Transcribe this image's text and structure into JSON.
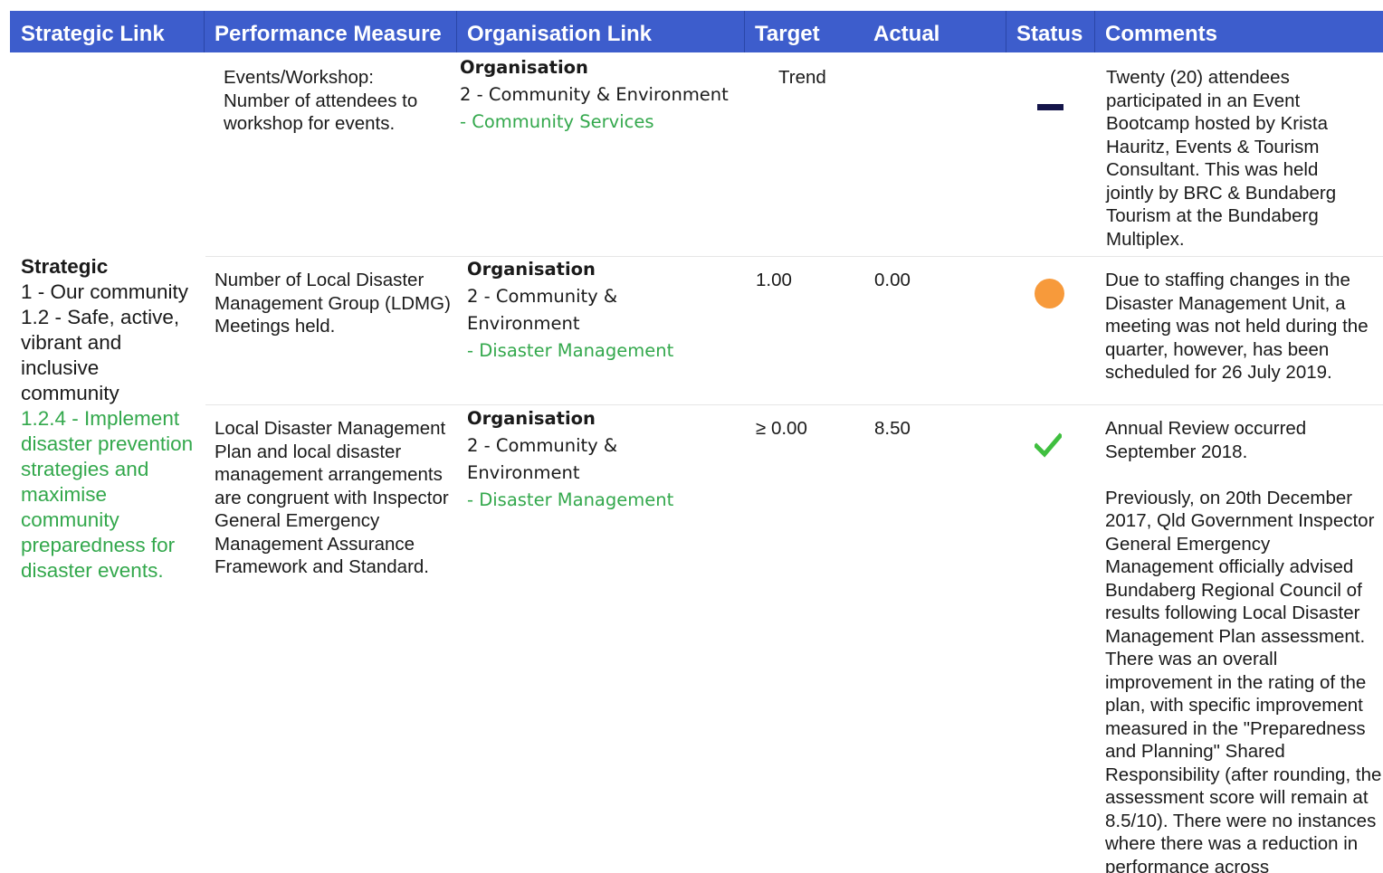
{
  "header": {
    "strategic_link": "Strategic Link",
    "performance_measure": "Performance Measure",
    "organisation_link": "Organisation Link",
    "target": "Target",
    "actual": "Actual",
    "status": "Status",
    "comments": "Comments"
  },
  "colors": {
    "header_bg": "#3d5dcc",
    "green_text": "#33a84c",
    "status_orange": "#f79a3b",
    "status_green": "#3fbf3f",
    "status_dash": "#14154a"
  },
  "strategic": {
    "title": "Strategic",
    "level1": "1 - Our community",
    "level2": "1.2 - Safe, active, vibrant and inclusive community",
    "level3": "1.2.4 - Implement disaster prevention strategies and maximise community preparedness for disaster events."
  },
  "rows": [
    {
      "measure": "Events/Workshop: Number of attendees to workshop for events.",
      "org_title": "Organisation",
      "org_level": "2 - Community & Environment",
      "org_sub": "- Community Services",
      "target": "Trend",
      "actual": "",
      "status": "no-change-dash-icon",
      "comments": "Twenty (20) attendees participated in an Event Bootcamp hosted by Krista Hauritz, Events & Tourism Consultant.  This was held jointly by BRC & Bundaberg Tourism at the Bundaberg Multiplex."
    },
    {
      "measure": "Number of Local Disaster Management Group (LDMG) Meetings held.",
      "org_title": "Organisation",
      "org_level": "2 - Community & Environment",
      "org_sub": "- Disaster Management",
      "target": "1.00",
      "actual": "0.00",
      "status": "orange-circle-icon",
      "comments": "Due to staffing changes in the Disaster Management Unit, a meeting was not held during the quarter, however, has been scheduled for 26 July 2019."
    },
    {
      "measure": "Local Disaster Management Plan and local disaster management arrangements are congruent with Inspector General Emergency Management  Assurance Framework and Standard.",
      "org_title": "Organisation",
      "org_level": "2 - Community & Environment",
      "org_sub": "- Disaster Management",
      "target": "≥ 0.00",
      "actual": "8.50",
      "status": "green-check-icon",
      "comments_p1": "Annual Review occurred September 2018.",
      "comments_p2": "Previously, on 20th December 2017, Qld Government Inspector General Emergency Management officially advised Bundaberg Regional Council of results following Local Disaster Management Plan assessment.  There was an overall improvement in the rating of the plan, with specific improvement measured in the \"Preparedness and Planning\" Shared Responsibility (after rounding, the assessment score will remain at 8.5/10).  There were no instances where there was a reduction in performance across"
    }
  ]
}
